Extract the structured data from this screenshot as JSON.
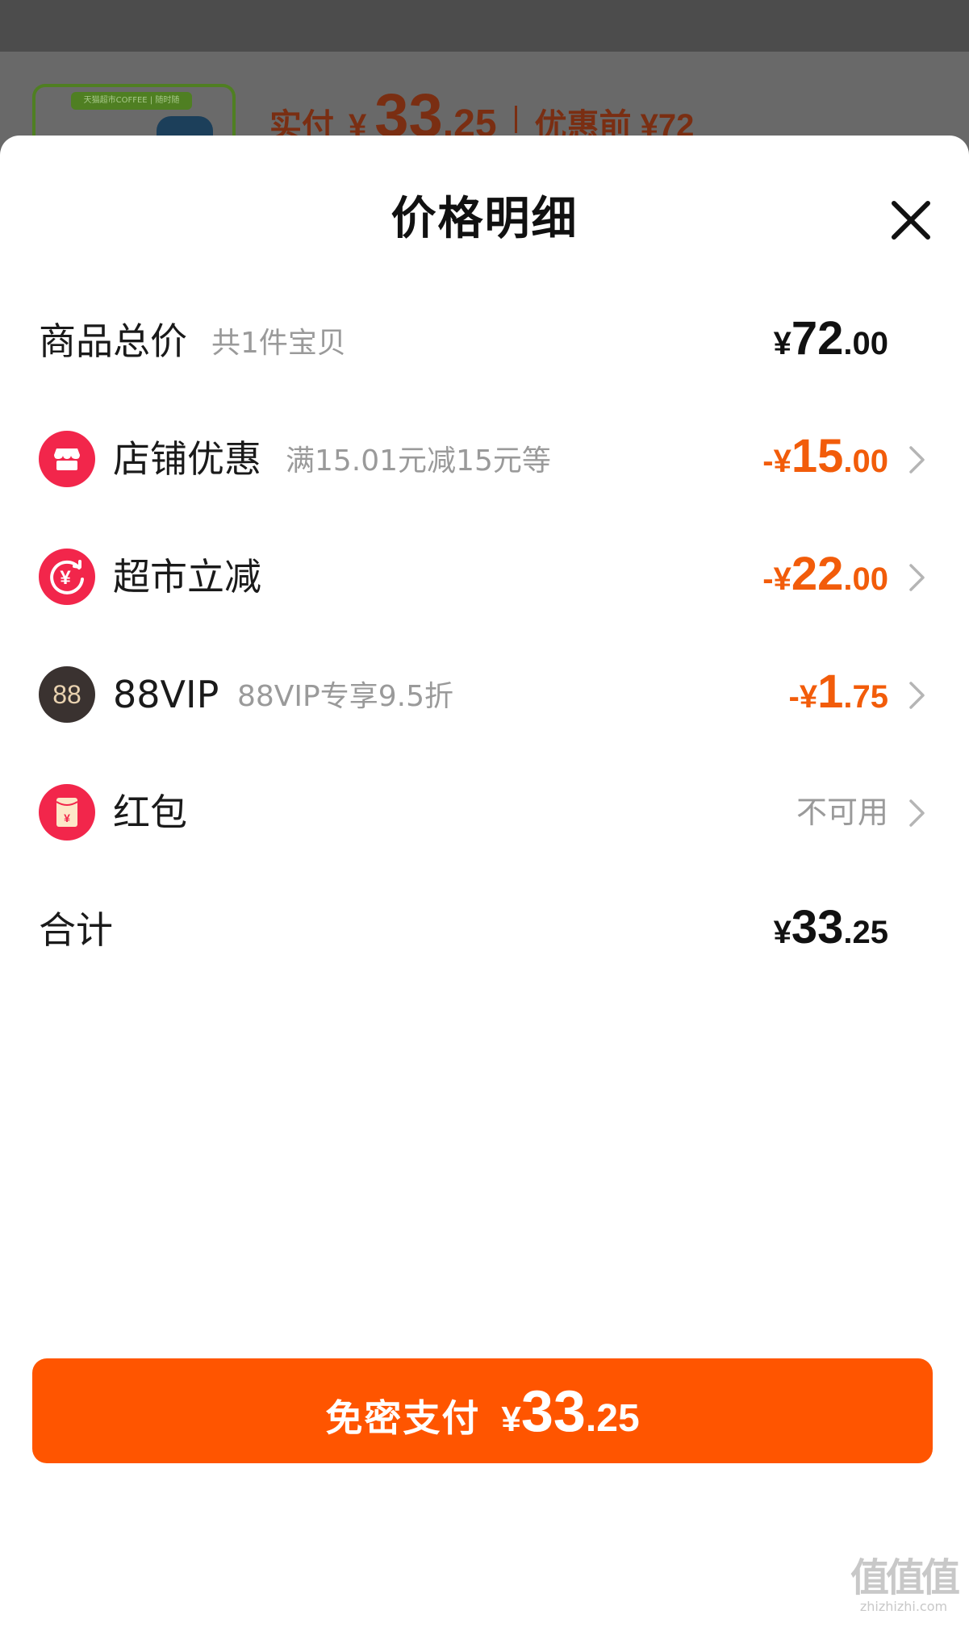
{
  "background": {
    "thumbnail_text": "天猫超市COFFEE | 随时随",
    "price_prefix": "实付",
    "price_yen": "¥",
    "price_int": "33",
    "price_dec": ".25",
    "original_label": "优惠前 ¥72"
  },
  "sheet": {
    "title": "价格明细",
    "close_icon": "close-icon"
  },
  "rows": {
    "total": {
      "label": "商品总价",
      "sub": "共1件宝贝",
      "sign": "¥",
      "int": "72",
      "dec": ".00"
    },
    "shop": {
      "icon": "shop-icon",
      "label": "店铺优惠",
      "sub": "满15.01元减15元等",
      "sign": "-¥",
      "int": "15",
      "dec": ".00"
    },
    "market": {
      "icon": "yen-refresh-icon",
      "label": "超市立减",
      "sign": "-¥",
      "int": "22",
      "dec": ".00"
    },
    "vip": {
      "icon": "88vip-badge-icon",
      "badge_text": "88",
      "label": "88VIP",
      "sub": "88VIP专享9.5折",
      "sign": "-¥",
      "int": "1",
      "dec": ".75"
    },
    "redpacket": {
      "icon": "red-envelope-icon",
      "label": "红包",
      "status": "不可用"
    },
    "sum": {
      "label": "合计",
      "sign": "¥",
      "int": "33",
      "dec": ".25"
    }
  },
  "pay_button": {
    "label": "免密支付",
    "yen": "¥",
    "int": "33",
    "dec": ".25"
  },
  "watermark": {
    "logo": "值值值",
    "url": "zhizhizhi.com"
  },
  "colors": {
    "accent": "#ff5500",
    "discount": "#f25c0a",
    "shop_icon": "#f2264b",
    "vip_icon": "#3a3230"
  }
}
